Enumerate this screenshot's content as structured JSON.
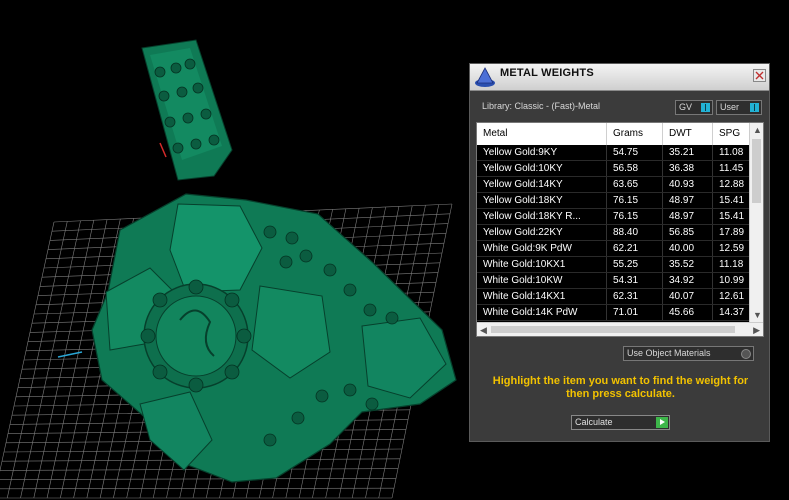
{
  "dialog": {
    "title": "METAL WEIGHTS",
    "library_label": "Library: Classic - (Fast)-Metal",
    "toggles": [
      {
        "label": "GV"
      },
      {
        "label": "User"
      }
    ],
    "columns": [
      "Metal",
      "Grams",
      "DWT",
      "SPG"
    ],
    "rows": [
      [
        "Yellow Gold:9KY",
        "54.75",
        "35.21",
        "11.08"
      ],
      [
        "Yellow Gold:10KY",
        "56.58",
        "36.38",
        "11.45"
      ],
      [
        "Yellow Gold:14KY",
        "63.65",
        "40.93",
        "12.88"
      ],
      [
        "Yellow Gold:18KY",
        "76.15",
        "48.97",
        "15.41"
      ],
      [
        "Yellow Gold:18KY R...",
        "76.15",
        "48.97",
        "15.41"
      ],
      [
        "Yellow Gold:22KY",
        "88.40",
        "56.85",
        "17.89"
      ],
      [
        "White Gold:9K PdW",
        "62.21",
        "40.00",
        "12.59"
      ],
      [
        "White Gold:10KX1",
        "55.25",
        "35.52",
        "11.18"
      ],
      [
        "White Gold:10KW",
        "54.31",
        "34.92",
        "10.99"
      ],
      [
        "White Gold:14KX1",
        "62.31",
        "40.07",
        "12.61"
      ],
      [
        "White Gold:14K PdW",
        "71.01",
        "45.66",
        "14.37"
      ]
    ],
    "use_object_materials_label": "Use Object Materials",
    "instructions": "Highlight the item you want to find the weight for then press calculate.",
    "calculate_label": "Calculate"
  },
  "colors": {
    "model": "#0f7a55",
    "grid": "#8a8a8a",
    "instruction_text": "#f2c200",
    "toggle_on": "#22b3d6",
    "calculate_play": "#3db64a"
  }
}
